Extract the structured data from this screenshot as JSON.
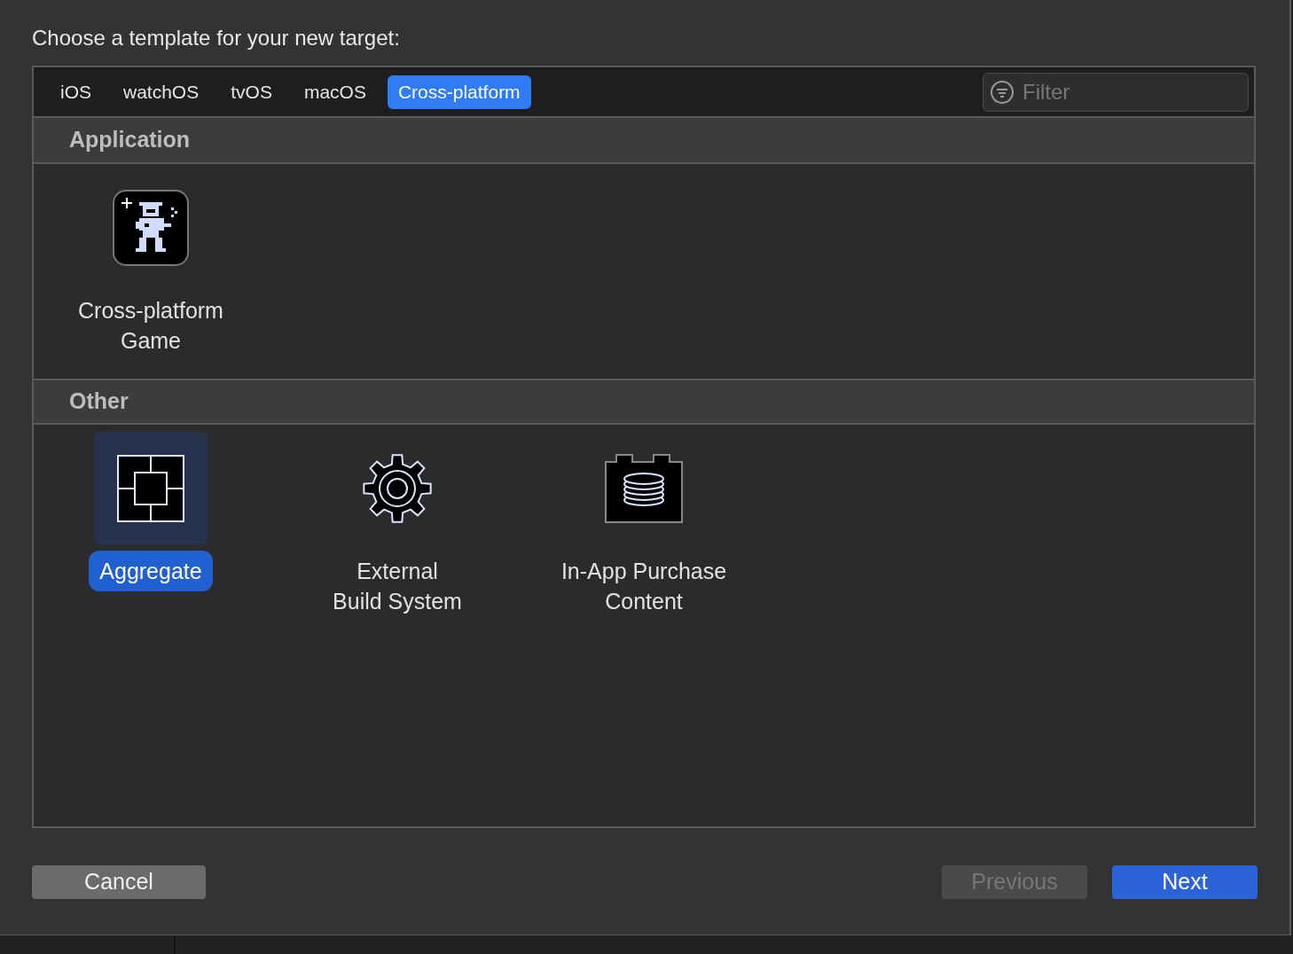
{
  "title": "Choose a template for your new target:",
  "tabs": [
    {
      "label": "iOS",
      "selected": false
    },
    {
      "label": "watchOS",
      "selected": false
    },
    {
      "label": "tvOS",
      "selected": false
    },
    {
      "label": "macOS",
      "selected": false
    },
    {
      "label": "Cross-platform",
      "selected": true
    }
  ],
  "filter": {
    "placeholder": "Filter"
  },
  "sections": [
    {
      "title": "Application",
      "templates": [
        {
          "label": "Cross-platform\nGame",
          "kind": "game",
          "selected": false
        }
      ]
    },
    {
      "title": "Other",
      "templates": [
        {
          "label": "Aggregate",
          "kind": "aggregate",
          "selected": true
        },
        {
          "label": "External\nBuild System",
          "kind": "gear",
          "selected": false
        },
        {
          "label": "In-App Purchase\nContent",
          "kind": "purchase",
          "selected": false
        }
      ]
    }
  ],
  "buttons": [
    {
      "label": "Cancel",
      "kind": "cancel",
      "disabled": false
    },
    {
      "label": "Previous",
      "kind": "secondary",
      "disabled": true
    },
    {
      "label": "Next",
      "kind": "primary",
      "disabled": false
    }
  ]
}
